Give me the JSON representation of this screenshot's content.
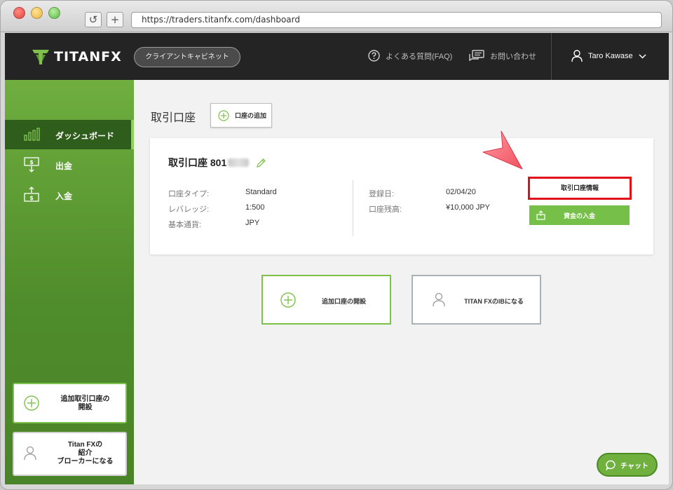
{
  "browser": {
    "url": "https://traders.titanfx.com/dashboard",
    "reload_icon": "↺",
    "newtab_icon": "+"
  },
  "header": {
    "logo_text": "TITANFX",
    "cabinet_label": "クライアントキャビネット",
    "faq_label": "よくある質問(FAQ)",
    "contact_label": "お問い合わせ",
    "user_name": "Taro Kawase"
  },
  "sidebar": {
    "items": [
      {
        "label": "ダッシュボード",
        "icon": "chart-icon",
        "active": true
      },
      {
        "label": "出金",
        "icon": "withdraw-icon"
      },
      {
        "label": "入金",
        "icon": "deposit-icon"
      }
    ],
    "open_account_card": "追加取引口座の\n開設",
    "ib_card": "Titan FXの\n紹介\nブローカーになる"
  },
  "main": {
    "title": "取引口座",
    "add_account_label": "口座の追加",
    "account": {
      "name_prefix": "取引口座 801",
      "type_key": "口座タイプ:",
      "type_val": "Standard",
      "leverage_key": "レバレッジ:",
      "leverage_val": "1:500",
      "currency_key": "基本通貨:",
      "currency_val": "JPY",
      "reg_key": "登録日:",
      "reg_val": "02/04/20",
      "balance_key": "口座残高:",
      "balance_val": "¥10,000 JPY",
      "info_button": "取引口座情報",
      "deposit_button": "資金の入金"
    },
    "open_additional": "追加口座の開設",
    "become_ib": "TITAN FXのIBになる",
    "chat_label": "チャット"
  },
  "colors": {
    "accent_green": "#76c04a",
    "sidebar_dark": "#2f5d1c",
    "header_bg": "#242424",
    "highlight_red": "#e0101a",
    "pointer": "#ff6a78"
  }
}
